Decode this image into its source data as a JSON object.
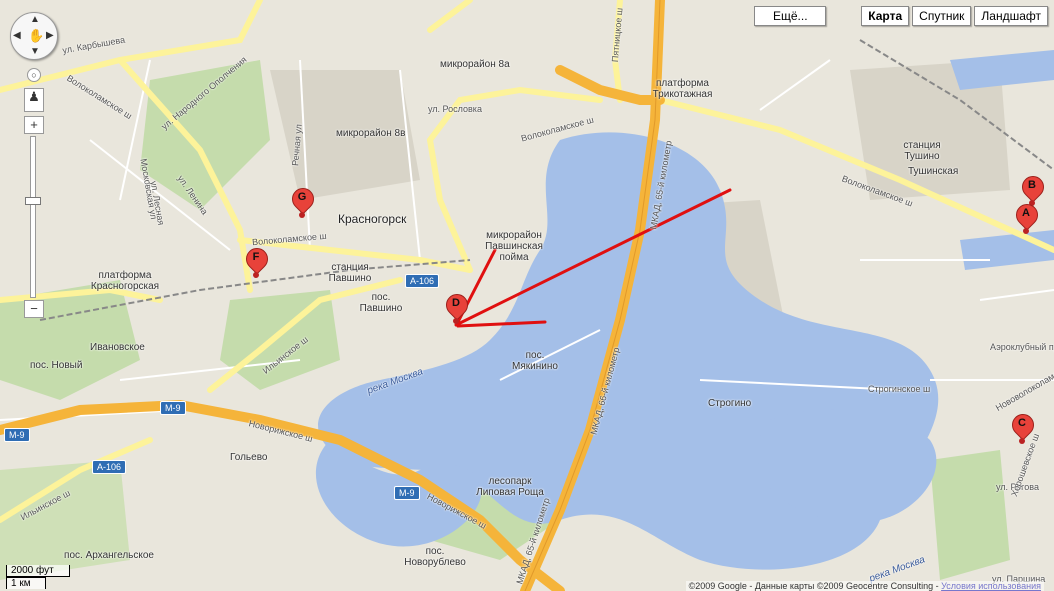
{
  "controls": {
    "more_label": "Ещё...",
    "map_types": [
      {
        "label": "Карта",
        "active": true
      },
      {
        "label": "Спутник",
        "active": false
      },
      {
        "label": "Ландшафт",
        "active": false
      }
    ],
    "zoom_in": "+",
    "zoom_out": "−",
    "zoom_level": 13
  },
  "scale": {
    "imperial": "2000 фут",
    "metric": "1 км"
  },
  "copyright": {
    "text": "©2009 Google - Данные карты ©2009 Geocentre Consulting - ",
    "terms_link": "Условия использования"
  },
  "labels": {
    "krasnogorsk": "Красногорск",
    "pavshino": "пос. Павшино",
    "myakinino": "пос. Мякинино",
    "ivanovskoe": "Ивановское",
    "novyi": "пос. Новый",
    "golyevo": "Гольево",
    "arkhangelskoe": "пос. Архангельское",
    "novorublevo": "пос. Новорублево",
    "mkr8a": "микрорайон 8а",
    "mkr8v": "микрорайон 8в",
    "pavshinskaya": "микрорайон Павшинская пойма",
    "platform_trikotazh": "платформа Трикотажная",
    "platform_krasnogorsk": "платформа Красногорская",
    "st_pavshino": "станция Павшино",
    "st_tushino": "станция Тушино",
    "tushinskaya": "Тушинская",
    "strogino": "Строгино",
    "strogino_sh": "Строгинское ш",
    "volok_1": "Волоколамское ш",
    "volok_2": "Волоколамское ш",
    "volok_3": "Волоколамское ш",
    "volok_4": "Волоколамское ш",
    "ilinskoe_1": "Ильинское ш",
    "ilinskoe_2": "Ильинское ш",
    "novorizhskoe_1": "Новорижское ш",
    "novorizhskoe_2": "Новорижское ш",
    "mkad_1": "МКАД, 65-й километр",
    "mkad_2": "МКАД, 66-й километр",
    "mkad_3": "МКАД, 65-й километр",
    "reka_moskva_1": "река Москва",
    "reka_moskva_2": "река Москва",
    "lesopark": "лесопарк Липовая Роща",
    "rosslovka": "ул. Рословка",
    "karbysheva": "ул. Карбышева",
    "narodnogo": "ул. Народного Ополчения",
    "leninа": "ул. Ленина",
    "rechnaya": "Речная ул",
    "moskovskaya": "Московская ул",
    "lesnaya": "ул. Лесная",
    "pyatnitskoe": "Пятницкое ш",
    "novovolok": "Нововолоколамское ш",
    "aeroclubnaya": "Аэроклубный пр",
    "parshina": "ул. Паршина",
    "rogova": "ул. Рогова",
    "khoroshevo": "Хорошевское ш"
  },
  "shields": {
    "a106_1": "A-106",
    "a106_2": "A-106",
    "m9_1": "M-9",
    "m9_2": "M-9",
    "m9_3": "M-9"
  },
  "markers": [
    {
      "letter": "G"
    },
    {
      "letter": "F"
    },
    {
      "letter": "D"
    },
    {
      "letter": "B"
    },
    {
      "letter": "A"
    },
    {
      "letter": "C"
    }
  ],
  "colors": {
    "water": "#a4bfe8",
    "land": "#e9e6dc",
    "green": "#c5dcac",
    "highway": "#f5b43a",
    "road": "#fffbb0",
    "arrow": "#e01010",
    "marker": "#e8423a"
  }
}
